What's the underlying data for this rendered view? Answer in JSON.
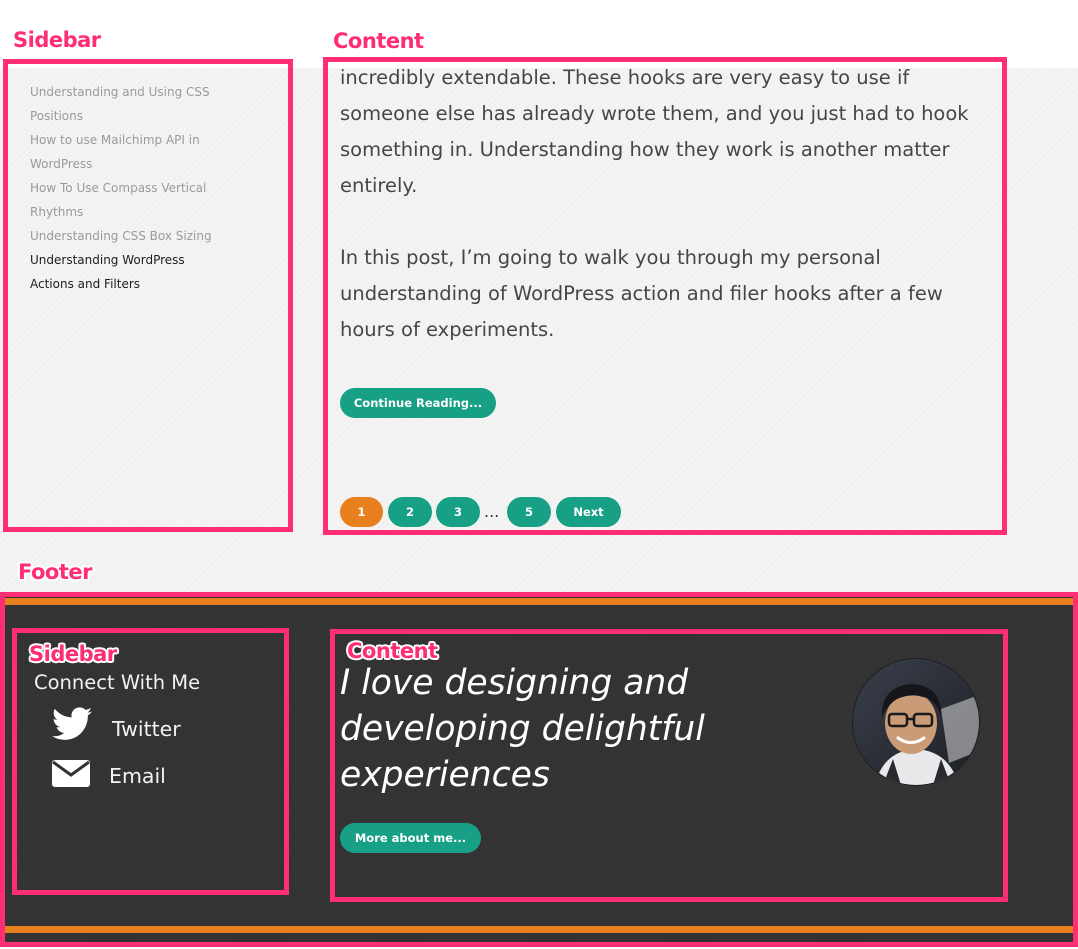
{
  "annotations": {
    "sidebar": "Sidebar",
    "content": "Content",
    "footer": "Footer",
    "footer_sidebar": "Sidebar",
    "footer_content": "Content"
  },
  "sidebar": {
    "items": [
      {
        "label": "Understanding and Using CSS"
      },
      {
        "label": "Positions"
      },
      {
        "label": "How to use Mailchimp API in"
      },
      {
        "label": "WordPress"
      },
      {
        "label": "How To Use Compass Vertical"
      },
      {
        "label": "Rhythms"
      },
      {
        "label": "Understanding CSS Box Sizing"
      },
      {
        "label": "Understanding WordPress"
      },
      {
        "label": "Actions and Filters"
      }
    ]
  },
  "content": {
    "paragraph_1": "incredibly extendable. These hooks are very easy to use if someone else has already wrote them, and you just had to hook something in. Understanding how they work is another matter entirely.",
    "paragraph_2": "In this post, I’m going to walk you through my personal understanding of WordPress action and filer hooks after a few hours of experiments.",
    "continue_label": "Continue Reading...",
    "pagination": {
      "pages": [
        "1",
        "2",
        "3",
        "5"
      ],
      "current": "1",
      "ellipsis": "...",
      "next_label": "Next"
    }
  },
  "footer": {
    "connect_heading": "Connect With Me",
    "twitter_label": "Twitter",
    "email_label": "Email",
    "tagline": "I love designing and developing delightful experiences",
    "more_label": "More about me..."
  },
  "colors": {
    "annotation": "#ff2d73",
    "accent_teal": "#17a085",
    "accent_orange": "#e8801f",
    "footer_bg": "#323232"
  },
  "icons": {
    "twitter": "twitter-bird-icon",
    "email": "envelope-icon",
    "avatar": "avatar"
  }
}
